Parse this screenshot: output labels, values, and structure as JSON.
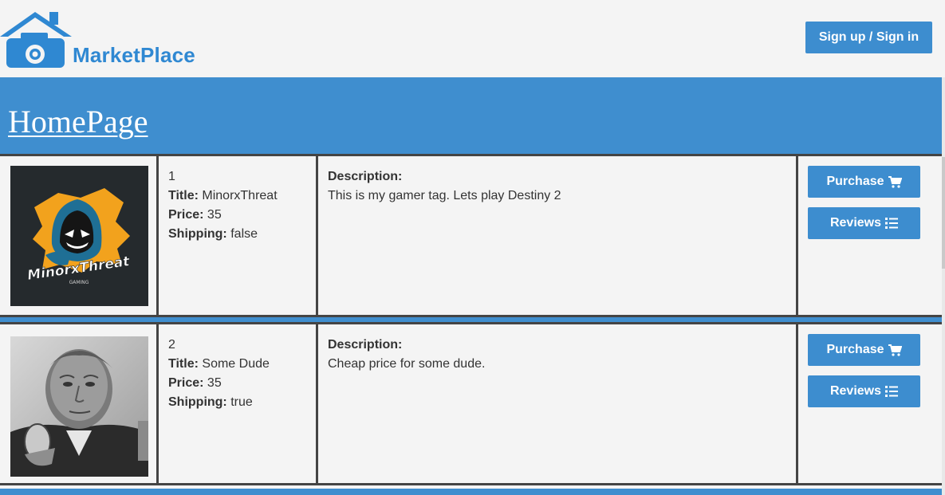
{
  "header": {
    "brand": "MarketPlace",
    "signin_label": "Sign up / Sign in"
  },
  "banner": {
    "title": "HomePage"
  },
  "listings": [
    {
      "id": "1",
      "title_label": "Title:",
      "title": "MinorxThreat",
      "price_label": "Price:",
      "price": "35",
      "shipping_label": "Shipping:",
      "shipping": "false",
      "description_label": "Description:",
      "description": "This is my gamer tag. Lets play Destiny 2",
      "purchase_label": "Purchase",
      "reviews_label": "Reviews",
      "image_icon": "minorxthreat-gaming-logo",
      "logo_text": "MinorxThreat",
      "logo_subtext": "GAMING"
    },
    {
      "id": "2",
      "title_label": "Title:",
      "title": "Some Dude",
      "price_label": "Price:",
      "price": "35",
      "shipping_label": "Shipping:",
      "shipping": "true",
      "description_label": "Description:",
      "description": "Cheap price for some dude.",
      "purchase_label": "Purchase",
      "reviews_label": "Reviews",
      "image_icon": "bw-portrait-photo"
    }
  ],
  "icons": {
    "purchase": "shopping-cart-icon",
    "reviews": "list-icon"
  },
  "colors": {
    "accent": "#3f8ecf",
    "button": "#3d8dcf",
    "brand_text": "#2f88d2",
    "border": "#444444",
    "background": "#f4f4f4"
  }
}
